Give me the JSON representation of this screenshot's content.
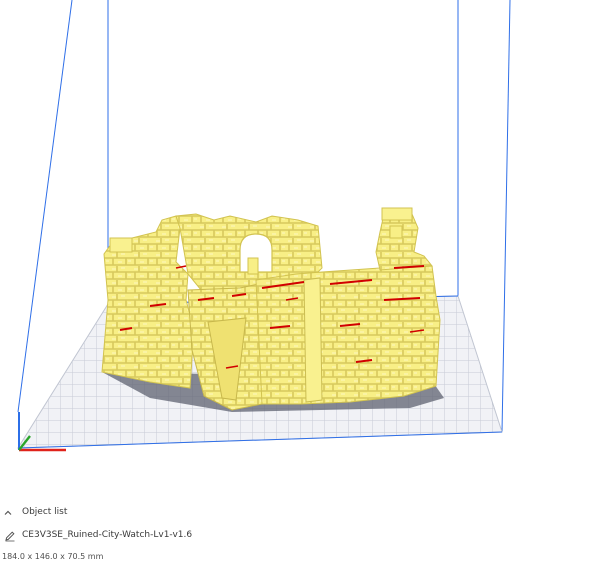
{
  "object_list": {
    "title": "Object list",
    "item_name": "CE3V3SE_Ruined-City-Watch-Lv1-v1.6",
    "dimensions": "184.0 x 146.0 x 70.5 mm"
  },
  "icons": {
    "toggle": "chevron-up-icon",
    "edit": "pencil-icon"
  },
  "colors": {
    "build_volume_lines": "#2f6fe8",
    "build_plate": "#c8cdd8",
    "build_plate_grid": "#eef0f5",
    "model": "#f7ec7a",
    "model_shadow": "#cfc25a",
    "overhang": "#d10000",
    "axis_x": "#e0221b",
    "axis_y": "#2aa52a",
    "axis_z": "#2c6fe8"
  }
}
